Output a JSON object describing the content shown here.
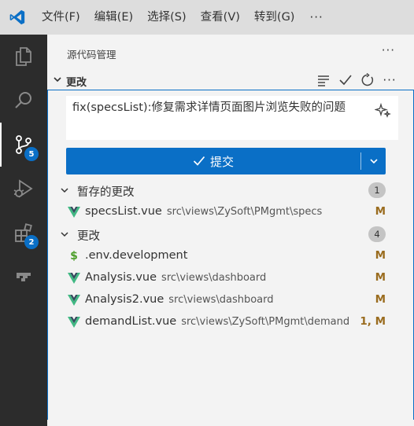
{
  "menu": {
    "items": [
      "文件(F)",
      "编辑(E)",
      "选择(S)",
      "查看(V)",
      "转到(G)"
    ],
    "more": "···"
  },
  "activity": {
    "scm_badge": "5",
    "extensions_badge": "2"
  },
  "sidebar": {
    "title": "源代码管理",
    "more": "···",
    "section": {
      "title": "更改",
      "more": "···"
    },
    "commit": {
      "message": "fix(specsList):修复需求详情页面图片浏览失败的问题",
      "button_label": "提交"
    },
    "staged": {
      "title": "暂存的更改",
      "count": "1",
      "files": [
        {
          "name": "specsList.vue",
          "path": "src\\views\\ZySoft\\PMgmt\\specs",
          "status": "M",
          "icon": "vue-icon"
        }
      ]
    },
    "changes": {
      "title": "更改",
      "count": "4",
      "files": [
        {
          "name": ".env.development",
          "path": "",
          "status": "M",
          "icon": "dollar-icon"
        },
        {
          "name": "Analysis.vue",
          "path": "src\\views\\dashboard",
          "status": "M",
          "icon": "vue-icon"
        },
        {
          "name": "Analysis2.vue",
          "path": "src\\views\\dashboard",
          "status": "M",
          "icon": "vue-icon"
        },
        {
          "name": "demandList.vue",
          "path": "src\\views\\ZySoft\\PMgmt\\demand",
          "status": "1, M",
          "icon": "vue-icon"
        }
      ]
    }
  },
  "colors": {
    "accent": "#0a6fc6",
    "vue_green": "#41b883",
    "modified": "#9a6c1f"
  }
}
